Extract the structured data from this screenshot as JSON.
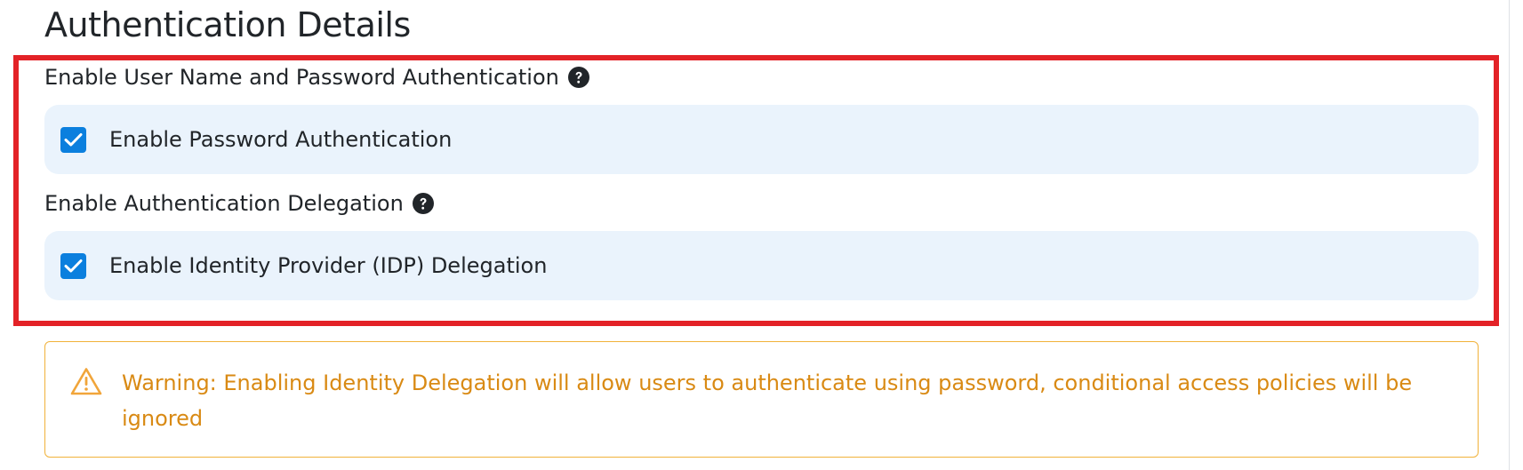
{
  "section": {
    "title": "Authentication Details"
  },
  "password_auth": {
    "label": "Enable User Name and Password Authentication",
    "help_icon": "question-circle-icon",
    "checkbox_label": "Enable Password Authentication",
    "checked": true
  },
  "delegation": {
    "label": "Enable Authentication Delegation",
    "help_icon": "question-circle-icon",
    "checkbox_label": "Enable Identity Provider (IDP) Delegation",
    "checked": true
  },
  "warning": {
    "icon": "warning-triangle-icon",
    "text": "Warning: Enabling Identity Delegation will allow users to authenticate using password, conditional access policies will be ignored"
  },
  "colors": {
    "accent": "#0b7fde",
    "highlight": "#e32227",
    "warning": "#d98a14",
    "row_background": "#eaf3fc"
  }
}
